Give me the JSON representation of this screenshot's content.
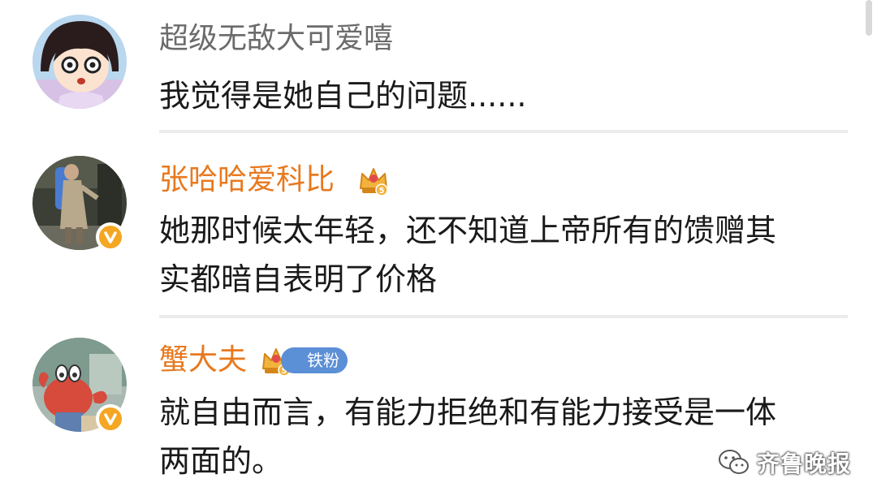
{
  "comments": [
    {
      "username": "超级无敌大可爱嘻",
      "text_lines": [
        "我觉得是她自己的问题......"
      ],
      "avatar_icon": "cartoon-girl-avatar",
      "verified": false,
      "vip_level": null,
      "fan_badge": null
    },
    {
      "username": "张哈哈爱科比",
      "text_lines": [
        "她那时候太年轻，还不知道上帝所有的馈赠其",
        "实都暗自表明了价格"
      ],
      "avatar_icon": "street-photo-avatar",
      "verified": true,
      "vip_level": "5",
      "fan_badge": null
    },
    {
      "username": "蟹大夫",
      "text_lines": [
        "就自由而言，有能力拒绝和有能力接受是一体",
        "两面的。"
      ],
      "avatar_icon": "crab-cartoon-avatar",
      "verified": true,
      "vip_level": "5",
      "fan_badge": "铁粉"
    }
  ],
  "watermark": {
    "icon": "wechat-icon",
    "text": "齐鲁晚报"
  },
  "colors": {
    "vip_name": "#e8791f",
    "plain_name": "#6b6b6b",
    "body_text": "#1a1a1a",
    "verified_badge": "#f5a623",
    "fan_badge": "#5b8fd6",
    "divider": "#ececec"
  }
}
